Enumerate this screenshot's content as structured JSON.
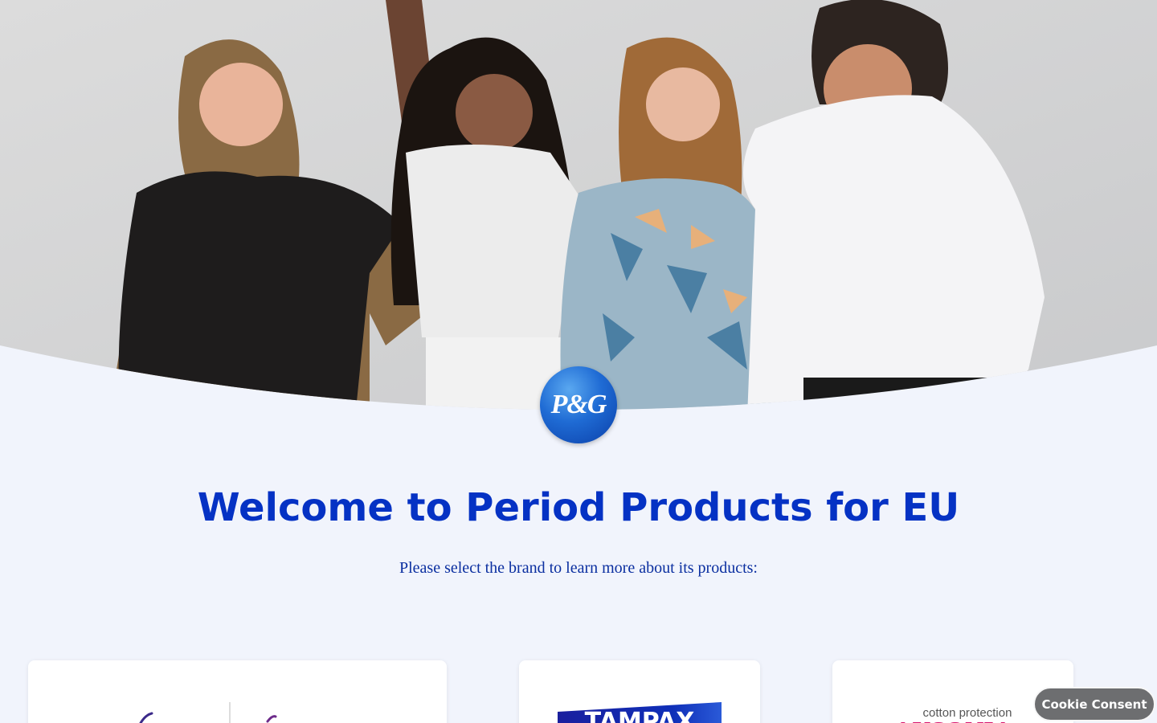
{
  "hero": {
    "image_alt": "Four friends laughing together against a light wall"
  },
  "logo": {
    "text": "P&G"
  },
  "welcome": {
    "title": "Welcome to Period Products for EU",
    "subtitle": "Please select the brand to learn more about its products:"
  },
  "brands": [
    {
      "name": "Always / Discreet"
    },
    {
      "name": "Tampax",
      "logo_text": "TAMPAX"
    },
    {
      "name": "Ausonia",
      "logo_text": "AUSONIA",
      "tagline": "cotton protection"
    }
  ],
  "cookie": {
    "label": "Cookie Consent"
  },
  "colors": {
    "background": "#f1f4fc",
    "brand_blue": "#0532c4",
    "cookie_bg": "#6d6e70"
  }
}
